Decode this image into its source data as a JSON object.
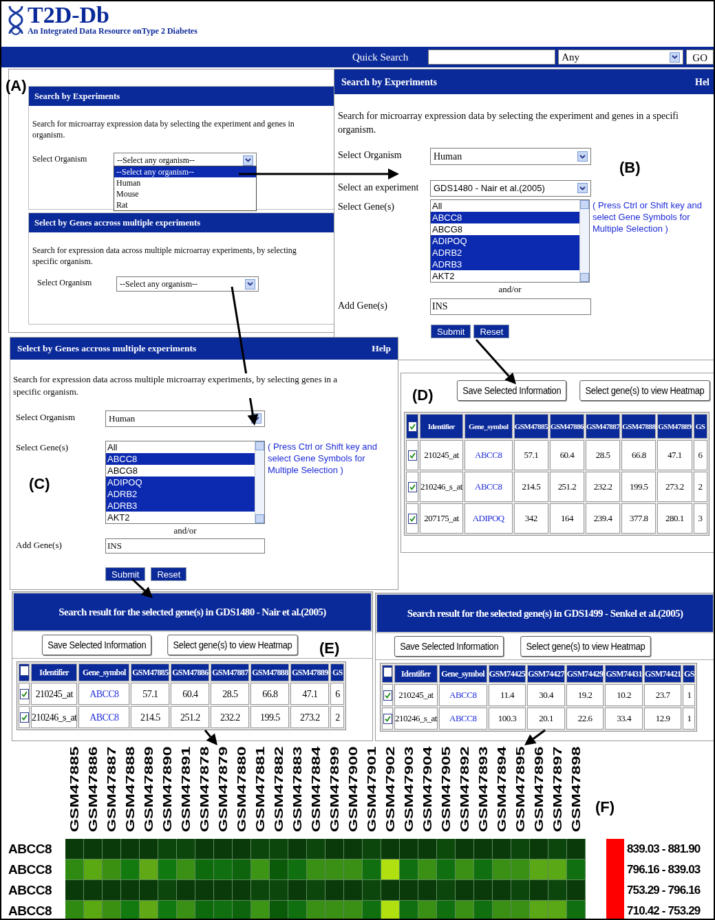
{
  "header": {
    "logo": "T2D-Db",
    "tagline": "An Integrated Data Resource onType 2 Diabetes"
  },
  "quick_search": {
    "label": "Quick Search",
    "scope": "Any",
    "button": "GO"
  },
  "panel_a": {
    "label": "(A)",
    "experiments": {
      "title": "Search by Experiments",
      "description_lines": [
        "Search for microarray expression data by selecting the experiment and genes in",
        "organism."
      ],
      "organism_label": "Select Organism",
      "organism": "--Select any organism--",
      "expanded": true,
      "options": [
        {
          "label": "--Select any organism--",
          "selected": true
        },
        {
          "label": "Human",
          "selected": false
        },
        {
          "label": "Mouse",
          "selected": false
        },
        {
          "label": "Rat",
          "selected": false
        }
      ]
    },
    "genes": {
      "title": "Select by Genes accross multiple experiments",
      "description_lines": [
        "Search for expression data across multiple microarray experiments, by selecting",
        "specific organism."
      ],
      "organism_label": "Select Organism",
      "organism": "--Select any organism--"
    }
  },
  "panel_b": {
    "label": "(B)",
    "title": "Search by Experiments",
    "help": "Hel",
    "description_lines": [
      "Search for microarray expression data by selecting the experiment and genes in a specifi",
      "organism."
    ],
    "organism_label": "Select Organism",
    "organism": "Human",
    "experiment_label": "Select an experiment",
    "experiment": "GDS1480 - Nair et al.(2005)",
    "genes_label": "Select Gene(s)",
    "genes": [
      {
        "name": "All",
        "selected": false
      },
      {
        "name": "ABCC8",
        "selected": true
      },
      {
        "name": "ABCG8",
        "selected": false
      },
      {
        "name": "ADIPOQ",
        "selected": true
      },
      {
        "name": "ADRB2",
        "selected": true
      },
      {
        "name": "ADRB3",
        "selected": true
      },
      {
        "name": "AKT2",
        "selected": false
      }
    ],
    "hint_lines": [
      "( Press Ctrl or Shift key and",
      "select Gene Symbols for",
      "Multiple Selection )"
    ],
    "and_or": "and/or",
    "add_label": "Add Gene(s)",
    "add_value": "INS",
    "submit": "Submit",
    "reset": "Reset"
  },
  "panel_c": {
    "label": "(C)",
    "title": "Select by Genes accross multiple experiments",
    "help": "Help",
    "description_lines": [
      "Search for expression data across multiple microarray experiments, by selecting genes in a",
      "specific organism."
    ],
    "organism_label": "Select Organism",
    "organism": "Human",
    "genes_label": "Select Gene(s)",
    "genes": [
      {
        "name": "All",
        "selected": false
      },
      {
        "name": "ABCC8",
        "selected": true
      },
      {
        "name": "ABCG8",
        "selected": false
      },
      {
        "name": "ADIPOQ",
        "selected": true
      },
      {
        "name": "ADRB2",
        "selected": true
      },
      {
        "name": "ADRB3",
        "selected": true
      },
      {
        "name": "AKT2",
        "selected": false
      }
    ],
    "hint_lines": [
      "( Press Ctrl or Shift key and",
      "select Gene Symbols for",
      "Multiple Selection )"
    ],
    "and_or": "and/or",
    "add_label": "Add Gene(s)",
    "add_value": "INS",
    "submit": "Submit",
    "reset": "Reset"
  },
  "panel_d": {
    "label": "(D)",
    "buttons": [
      "Save Selected Information",
      "Select gene(s) to view Heatmap"
    ],
    "table": {
      "all_checked": true,
      "columns": [
        "Identifier",
        "Gene_symbol",
        "GSM47885",
        "GSM47886",
        "GSM47887",
        "GSM47888",
        "GSM47889",
        "GS"
      ],
      "rows": [
        {
          "checked": true,
          "cells": [
            "210245_at",
            "ABCC8",
            "57.1",
            "60.4",
            "28.5",
            "66.8",
            "47.1",
            "6"
          ]
        },
        {
          "checked": true,
          "cells": [
            "210246_s_at",
            "ABCC8",
            "214.5",
            "251.2",
            "232.2",
            "199.5",
            "273.2",
            "2"
          ]
        },
        {
          "checked": true,
          "cells": [
            "207175_at",
            "ADIPOQ",
            "342",
            "164",
            "239.4",
            "377.8",
            "280.1",
            "3"
          ]
        }
      ]
    }
  },
  "panel_e": {
    "label": "(E)",
    "title": "Search result for the selected gene(s) in GDS1480 - Nair et al.(2005)",
    "buttons": [
      "Save Selected Information",
      "Select gene(s) to view Heatmap"
    ],
    "table": {
      "all_checked": false,
      "columns": [
        "Identifier",
        "Gene_symbol",
        "GSM47885",
        "GSM47886",
        "GSM47887",
        "GSM47888",
        "GSM47889",
        "GS"
      ],
      "rows": [
        {
          "checked": true,
          "cells": [
            "210245_at",
            "ABCC8",
            "57.1",
            "60.4",
            "28.5",
            "66.8",
            "47.1",
            "6"
          ]
        },
        {
          "checked": true,
          "cells": [
            "210246_s_at",
            "ABCC8",
            "214.5",
            "251.2",
            "232.2",
            "199.5",
            "273.2",
            "2"
          ]
        }
      ]
    }
  },
  "panel_e2": {
    "title": "Search result for the selected gene(s) in GDS1499 - Senkel et al.(2005)",
    "buttons": [
      "Save Selected Information",
      "Select gene(s) to view Heatmap"
    ],
    "table": {
      "all_checked": false,
      "columns": [
        "Identifier",
        "Gene_symbol",
        "GSM74425",
        "GSM74427",
        "GSM74429",
        "GSM74431",
        "GSM74421",
        "GS"
      ],
      "rows": [
        {
          "checked": true,
          "cells": [
            "210245_at",
            "ABCC8",
            "11.4",
            "30.4",
            "19.2",
            "10.2",
            "23.7",
            "1"
          ]
        },
        {
          "checked": true,
          "cells": [
            "210246_s_at",
            "ABCC8",
            "100.3",
            "20.1",
            "22.6",
            "33.4",
            "12.9",
            "1"
          ]
        }
      ]
    }
  },
  "panel_f": {
    "label": "(F)",
    "columns": [
      "GSM47885",
      "GSM47886",
      "GSM47887",
      "GSM47888",
      "GSM47889",
      "GSM47890",
      "GSM47891",
      "GSM47878",
      "GSM47879",
      "GSM47880",
      "GSM47881",
      "GSM47882",
      "GSM47883",
      "GSM47884",
      "GSM47899",
      "GSM47900",
      "GSM47901",
      "GSM47902",
      "GSM47903",
      "GSM47904",
      "GSM47905",
      "GSM47892",
      "GSM47893",
      "GSM47894",
      "GSM47895",
      "GSM47896",
      "GSM47897",
      "GSM47898"
    ],
    "rows": [
      {
        "gene": "ABCC8",
        "cells": [
          {
            "color": "#0a3a0a"
          },
          {
            "color": "#0a3a0a"
          },
          {
            "color": "#0a3a0a"
          },
          {
            "color": "#0a3a0a"
          },
          {
            "color": "#0a3a0a"
          },
          {
            "color": "#0c460c"
          },
          {
            "color": "#0c460c"
          },
          {
            "color": "#0a3a0a"
          },
          {
            "color": "#0a3a0a"
          },
          {
            "color": "#0a3a0a"
          },
          {
            "color": "#0c460c"
          },
          {
            "color": "#0c460c"
          },
          {
            "color": "#0a3a0a"
          },
          {
            "color": "#0c460c"
          },
          {
            "color": "#0a3a0a"
          },
          {
            "color": "#0a3a0a"
          },
          {
            "color": "#0c460c"
          },
          {
            "color": "#0a3a0a"
          },
          {
            "color": "#0a3a0a"
          },
          {
            "color": "#0a3a0a"
          },
          {
            "color": "#0c4a0c"
          },
          {
            "color": "#0a3a0a"
          },
          {
            "color": "#0a3a0a"
          },
          {
            "color": "#0a3a0a"
          },
          {
            "color": "#0c460c"
          },
          {
            "color": "#0a3a0a"
          },
          {
            "color": "#0c460c"
          },
          {
            "color": "#0a3a0a"
          }
        ]
      },
      {
        "gene": "ABCC8",
        "cells": [
          {
            "color": "#2e8a10"
          },
          {
            "color": "#5aa812"
          },
          {
            "color": "#3a9010"
          },
          {
            "color": "#137a10"
          },
          {
            "color": "#60a815"
          },
          {
            "color": "#107a10"
          },
          {
            "color": "#3a9015"
          },
          {
            "color": "#0d6a0d"
          },
          {
            "color": "#107010"
          },
          {
            "color": "#0d640d"
          },
          {
            "color": "#3d9515"
          },
          {
            "color": "#0a5a0a"
          },
          {
            "color": "#107010"
          },
          {
            "color": "#3a9015"
          },
          {
            "color": "#3a9015"
          },
          {
            "color": "#3a9015"
          },
          {
            "color": "#107010"
          },
          {
            "color": "#b0e010"
          },
          {
            "color": "#107010"
          },
          {
            "color": "#3a9015"
          },
          {
            "color": "#107010"
          },
          {
            "color": "#3a9015"
          },
          {
            "color": "#107010"
          },
          {
            "color": "#3a9015"
          },
          {
            "color": "#3a9015"
          },
          {
            "color": "#5aa815"
          },
          {
            "color": "#5aa815"
          },
          {
            "color": "#107010"
          }
        ]
      },
      {
        "gene": "ABCC8",
        "cells": [
          {
            "color": "#0a3a0a"
          },
          {
            "color": "#0a3a0a"
          },
          {
            "color": "#0a3a0a"
          },
          {
            "color": "#0a3a0a"
          },
          {
            "color": "#0a3a0a"
          },
          {
            "color": "#0c460c"
          },
          {
            "color": "#0a3a0a"
          },
          {
            "color": "#0a3a0a"
          },
          {
            "color": "#0a3a0a"
          },
          {
            "color": "#0a3a0a"
          },
          {
            "color": "#0c460c"
          },
          {
            "color": "#0c460c"
          },
          {
            "color": "#0a3a0a"
          },
          {
            "color": "#0c460c"
          },
          {
            "color": "#0a3a0a"
          },
          {
            "color": "#0a3a0a"
          },
          {
            "color": "#0c460c"
          },
          {
            "color": "#0a3a0a"
          },
          {
            "color": "#0a3a0a"
          },
          {
            "color": "#0a3a0a"
          },
          {
            "color": "#0c460c"
          },
          {
            "color": "#0a3a0a"
          },
          {
            "color": "#0a3a0a"
          },
          {
            "color": "#0a3a0a"
          },
          {
            "color": "#0c460c"
          },
          {
            "color": "#0a3a0a"
          },
          {
            "color": "#0c460c"
          },
          {
            "color": "#0a3a0a"
          }
        ]
      },
      {
        "gene": "ABCC8",
        "cells": [
          {
            "color": "#2e8a10"
          },
          {
            "color": "#5aa812"
          },
          {
            "color": "#3a9010"
          },
          {
            "color": "#137a10"
          },
          {
            "color": "#60a815"
          },
          {
            "color": "#107a10"
          },
          {
            "color": "#3a9015"
          },
          {
            "color": "#0d6a0d"
          },
          {
            "color": "#107010"
          },
          {
            "color": "#0d640d"
          },
          {
            "color": "#3d9515"
          },
          {
            "color": "#0a5a0a"
          },
          {
            "color": "#107010"
          },
          {
            "color": "#3a9015"
          },
          {
            "color": "#3a9015"
          },
          {
            "color": "#3a9015"
          },
          {
            "color": "#107010"
          },
          {
            "color": "#b0e010"
          },
          {
            "color": "#107010"
          },
          {
            "color": "#3a9015"
          },
          {
            "color": "#107010"
          },
          {
            "color": "#3a9015"
          },
          {
            "color": "#107010"
          },
          {
            "color": "#3a9015"
          },
          {
            "color": "#3a9015"
          },
          {
            "color": "#5aa815"
          },
          {
            "color": "#5aa815"
          },
          {
            "color": "#107010"
          }
        ]
      }
    ],
    "legend": [
      {
        "range": "839.03 - 881.90",
        "color": "#ff0000"
      },
      {
        "range": "796.16 - 839.03",
        "color": "#ff0000"
      },
      {
        "range": "753.29 - 796.16",
        "color": "#ff0000"
      },
      {
        "range": "710.42 - 753.29",
        "color": "#ff0000"
      }
    ]
  }
}
